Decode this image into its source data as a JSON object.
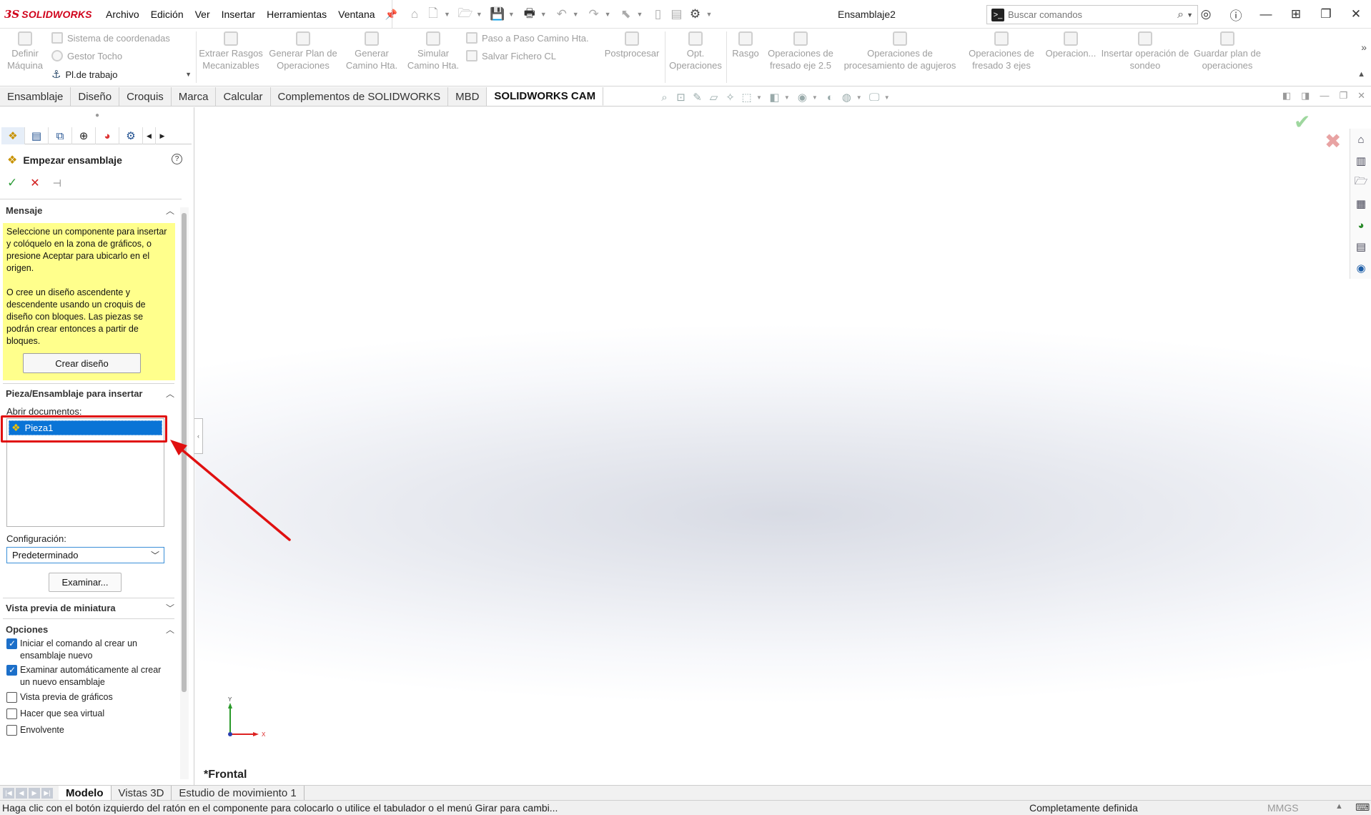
{
  "app": {
    "logo_text": "SOLIDWORKS",
    "logo_mark": "3S",
    "document_title": "Ensamblaje2",
    "menus": [
      "Archivo",
      "Edición",
      "Ver",
      "Insertar",
      "Herramientas",
      "Ventana"
    ],
    "search_placeholder": "Buscar comandos"
  },
  "ribbon": {
    "definir_maquina": "Definir Máquina",
    "sistema_coordenadas": "Sistema de coordenadas",
    "gestor_tocho": "Gestor Tocho",
    "pl_trabajo": "Pl.de trabajo",
    "extraer_rasgos": "Extraer Rasgos Mecanizables",
    "generar_plan": "Generar Plan de Operaciones",
    "generar_camino": "Generar Camino Hta.",
    "simular_camino": "Simular Camino Hta.",
    "paso_a_paso": "Paso a Paso Camino Hta.",
    "salvar_fichero": "Salvar Fichero CL",
    "postprocesar": "Postprocesar",
    "opt_operaciones": "Opt. Operaciones",
    "rasgo": "Rasgo",
    "fresado_25": "Operaciones de fresado eje 2.5",
    "procesamiento_agujeros": "Operaciones de procesamiento de agujeros",
    "fresado_3": "Operaciones de fresado 3 ejes",
    "operacion": "Operacion...",
    "insertar_sondeo": "Insertar operación de sondeo",
    "guardar_plan": "Guardar plan de operaciones"
  },
  "tabs": [
    "Ensamblaje",
    "Diseño",
    "Croquis",
    "Marca",
    "Calcular",
    "Complementos de SOLIDWORKS",
    "MBD",
    "SOLIDWORKS CAM"
  ],
  "active_tab": "SOLIDWORKS CAM",
  "property_manager": {
    "title": "Empezar ensamblaje",
    "help": "?",
    "mensaje": {
      "header": "Mensaje",
      "p1": "Seleccione un componente para insertar y colóquelo en la zona de gráficos, o presione Aceptar para ubicarlo en el origen.",
      "p2": "O cree un diseño ascendente y descendente usando un croquis de diseño con bloques. Las piezas se podrán crear entonces a partir de bloques.",
      "crear_button": "Crear diseño"
    },
    "insertar": {
      "header": "Pieza/Ensamblaje para insertar",
      "open_docs_label": "Abrir documentos:",
      "items": [
        "Pieza1"
      ],
      "config_label": "Configuración:",
      "config_value": "Predeterminado",
      "examinar_button": "Examinar..."
    },
    "vista_previa": {
      "header": "Vista previa de miniatura"
    },
    "opciones": {
      "header": "Opciones",
      "items": [
        {
          "label": "Iniciar el comando al crear un ensamblaje nuevo",
          "checked": true
        },
        {
          "label": "Examinar automáticamente al crear un nuevo ensamblaje",
          "checked": true
        },
        {
          "label": "Vista previa de gráficos",
          "checked": false
        },
        {
          "label": "Hacer que sea virtual",
          "checked": false
        },
        {
          "label": "Envolvente",
          "checked": false
        }
      ]
    }
  },
  "graphics": {
    "view_label": "*Frontal",
    "axis_x": "X",
    "axis_y": "Y"
  },
  "bottom_tabs": [
    "Modelo",
    "Vistas 3D",
    "Estudio de movimiento 1"
  ],
  "active_bottom_tab": "Modelo",
  "status": {
    "message": "Haga clic con el botón izquierdo del ratón en el componente para colocarlo o utilice el tabulador o el menú Girar para cambi...",
    "state": "Completamente definida",
    "units": "MMGS"
  },
  "colors": {
    "accent": "#0a74d6",
    "brand_red": "#d0021b",
    "message_bg": "#ffff8c",
    "annotation_red": "#e01010"
  }
}
